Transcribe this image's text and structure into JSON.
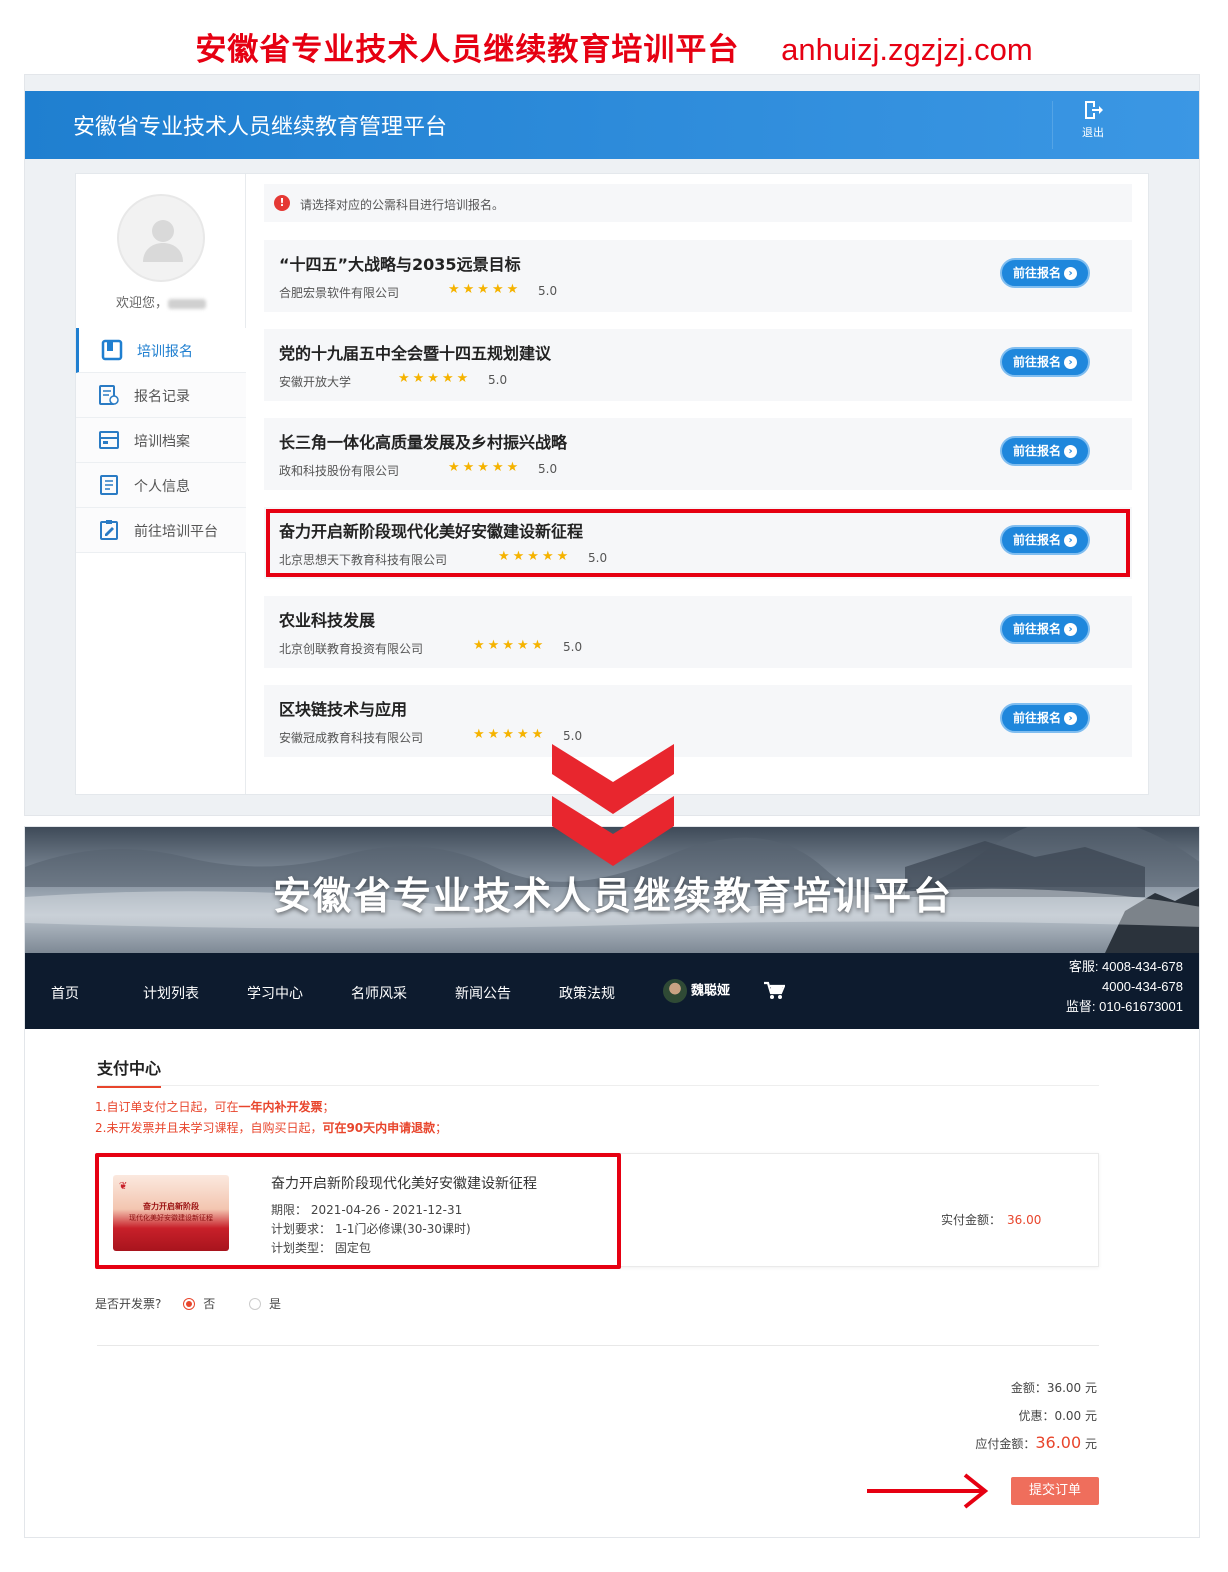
{
  "banner": {
    "title": "安徽省专业技术人员继续教育培训平台",
    "url": "anhuizj.zgzjzj.com"
  },
  "top": {
    "header_title": "安徽省专业技术人员继续教育管理平台",
    "logout_label": "退出",
    "welcome": "欢迎您，",
    "menu": [
      {
        "label": "培训报名",
        "icon": "book-icon"
      },
      {
        "label": "报名记录",
        "icon": "record-icon"
      },
      {
        "label": "培训档案",
        "icon": "archive-icon"
      },
      {
        "label": "个人信息",
        "icon": "profile-icon"
      },
      {
        "label": "前往培训平台",
        "icon": "platform-icon"
      }
    ],
    "notice": "请选择对应的公需科目进行培训报名。",
    "courses": [
      {
        "title": "“十四五”大战略与2035远景目标",
        "org": "合肥宏景软件有限公司",
        "rating": "5.0",
        "button": "前往报名"
      },
      {
        "title": "党的十九届五中全会暨十四五规划建议",
        "org": "安徽开放大学",
        "rating": "5.0",
        "button": "前往报名"
      },
      {
        "title": "长三角一体化高质量发展及乡村振兴战略",
        "org": "政和科技股份有限公司",
        "rating": "5.0",
        "button": "前往报名"
      },
      {
        "title": "奋力开启新阶段现代化美好安徽建设新征程",
        "org": "北京思想天下教育科技有限公司",
        "rating": "5.0",
        "button": "前往报名"
      },
      {
        "title": "农业科技发展",
        "org": "北京创联教育投资有限公司",
        "rating": "5.0",
        "button": "前往报名"
      },
      {
        "title": "区块链技术与应用",
        "org": "安徽冠成教育科技有限公司",
        "rating": "5.0",
        "button": "前往报名"
      }
    ]
  },
  "bottom": {
    "hero_title": "安徽省专业技术人员继续教育培训平台",
    "nav": [
      "首页",
      "计划列表",
      "学习中心",
      "名师风采",
      "新闻公告",
      "政策法规"
    ],
    "user_name": "魏聪娅",
    "contact": {
      "line1": "客服: 4008-434-678",
      "line2": "4000-434-678",
      "line3": "监督: 010-61673001"
    },
    "pay_title": "支付中心",
    "notes": {
      "n1_pre": "1.自订单支付之日起，可在",
      "n1_bold": "一年内补开发票",
      "n1_post": "；",
      "n2_pre": "2.未开发票并且未学习课程，自购买日起，",
      "n2_bold": "可在90天内申请退款",
      "n2_post": "；"
    },
    "order": {
      "thumb_line1": "奋力开启新阶段",
      "thumb_line2": "现代化美好安徽建设新征程",
      "title": "奋力开启新阶段现代化美好安徽建设新征程",
      "period": "期限：  2021-04-26 - 2021-12-31",
      "requirement": "计划要求：  1-1门必修课(30-30课时)",
      "type": "计划类型：  固定包",
      "pay_label": "实付金额：",
      "pay_amount": "36.00"
    },
    "invoice": {
      "question": "是否开发票?",
      "no": "否",
      "yes": "是"
    },
    "summary": {
      "amount": "金额：36.00 元",
      "discount": "优惠：0.00 元",
      "due_label": "应付金额：",
      "due_value": "36.00",
      "due_unit": " 元"
    },
    "submit": "提交订单"
  },
  "colors": {
    "accent_red": "#e60012",
    "brand_blue": "#1f7fd0",
    "pay_orange": "#e8452c"
  }
}
